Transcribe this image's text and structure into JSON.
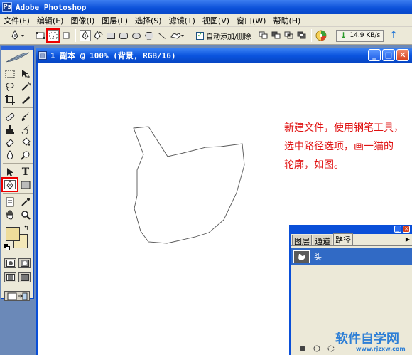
{
  "window": {
    "title": "Adobe Photoshop",
    "app_icon": "Ps"
  },
  "menu": [
    "文件(F)",
    "编辑(E)",
    "图像(I)",
    "图层(L)",
    "选择(S)",
    "滤镜(T)",
    "视图(V)",
    "窗口(W)",
    "帮助(H)"
  ],
  "options_bar": {
    "auto_add_delete_label": "自动添加/删除",
    "auto_add_delete_checked": true,
    "network_speed": "14.9 KB/s"
  },
  "document": {
    "title": "1 副本 @ 100% (背景, RGB/16)",
    "annotation_lines": [
      "新建文件，使用钢笔工具，",
      "选中路径选项，画一猫的",
      "轮廓，如图。"
    ]
  },
  "paths_palette": {
    "tabs": [
      "图层",
      "通道",
      "路径"
    ],
    "active_tab": 2,
    "items": [
      {
        "name": "头"
      }
    ]
  },
  "colors": {
    "foreground": "#eedc9a",
    "background": "#f4e8b8",
    "annotation": "#e01212",
    "highlight": "#ee0000"
  },
  "watermark": {
    "main": "软件自学网",
    "sub": "www.rjzxw.com"
  }
}
